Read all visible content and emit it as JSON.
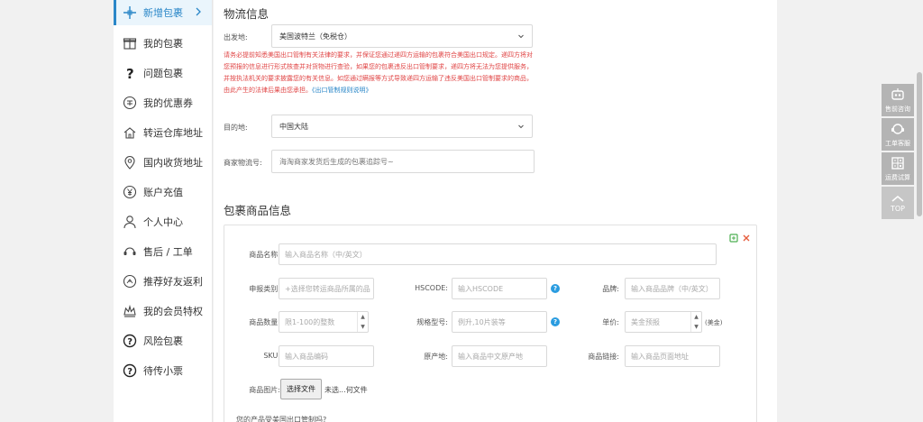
{
  "sidebar": {
    "items": [
      {
        "label": "新增包裹",
        "icon": "plus-cross-icon"
      },
      {
        "label": "我的包裹",
        "icon": "gift-box-icon"
      },
      {
        "label": "问题包裹",
        "icon": "question-mark-icon"
      },
      {
        "label": "我的优惠券",
        "icon": "coupon-icon"
      },
      {
        "label": "转运仓库地址",
        "icon": "home-icon"
      },
      {
        "label": "国内收货地址",
        "icon": "location-pin-icon"
      },
      {
        "label": "账户充值",
        "icon": "yen-circle-icon"
      },
      {
        "label": "个人中心",
        "icon": "person-icon"
      },
      {
        "label": "售后 / 工单",
        "icon": "headset-icon"
      },
      {
        "label": "推荐好友返利",
        "icon": "share-circle-icon"
      },
      {
        "label": "我的会员特权",
        "icon": "crown-icon"
      },
      {
        "label": "风险包裹",
        "icon": "warning-circle-icon"
      },
      {
        "label": "待传小票",
        "icon": "receipt-circle-icon"
      }
    ]
  },
  "logistics": {
    "title": "物流信息",
    "origin_label": "出发地:",
    "origin_value": "美国波特兰（免税仓）",
    "warning_text": "请务必提前知悉美国出口管制有关法律的要求，并保证您通过递四方运输的包裹符合美国出口规定。递四方将对您预报的信息进行形式核查并对货物进行查验，如果您的包裹违反出口管制要求，递四方将无法为您提供服务，并按执法机关的要求披露您的有关信息。如您通过瞒报等方式导致递四方运输了违反美国出口管制要求的商品，由此产生的法律后果由您承担。",
    "warning_link": "《出口管制规则说明》",
    "dest_label": "目的地:",
    "dest_value": "中国大陆",
    "tracking_label": "商家物流号:",
    "tracking_placeholder": "海淘商家发货后生成的包裹追踪号~"
  },
  "goods": {
    "title": "包裹商品信息",
    "name_label": "商品名称:",
    "name_placeholder": "输入商品名称（中/英文）",
    "category_label": "申报类别:",
    "category_placeholder": "+选择您转运商品所属的品",
    "hscode_label": "HSCODE:",
    "hscode_placeholder": "输入HSCODE",
    "brand_label": "品牌:",
    "brand_placeholder": "输入商品品牌（中/英文）",
    "qty_label": "商品数量:",
    "qty_placeholder": "限1-100的整数",
    "spec_label": "规格型号:",
    "spec_placeholder": "例升,10片装等",
    "price_label": "单价:",
    "price_placeholder": "美金预报",
    "price_unit": "(美金)",
    "sku_label": "SKU:",
    "sku_placeholder": "输入商品编码",
    "origin_label": "原产地:",
    "origin_placeholder": "输入商品中文原产地",
    "link_label": "商品链接:",
    "link_placeholder": "输入商品页面地址",
    "image_label": "商品图片:",
    "file_button": "选择文件",
    "file_status": "未选...何文件",
    "export_question": "您的产品受美国出口管制吗?"
  },
  "tools": [
    {
      "label": "售前咨询",
      "icon": "robot-icon"
    },
    {
      "label": "工单客服",
      "icon": "headset-icon"
    },
    {
      "label": "运费试算",
      "icon": "calculator-icon"
    },
    {
      "label": "TOP",
      "icon": "chevron-up-icon"
    }
  ],
  "colors": {
    "accent": "#2a87c8",
    "warning": "#e04545",
    "help": "#2a9ce0",
    "tool_bg": "#b4b4b4"
  }
}
